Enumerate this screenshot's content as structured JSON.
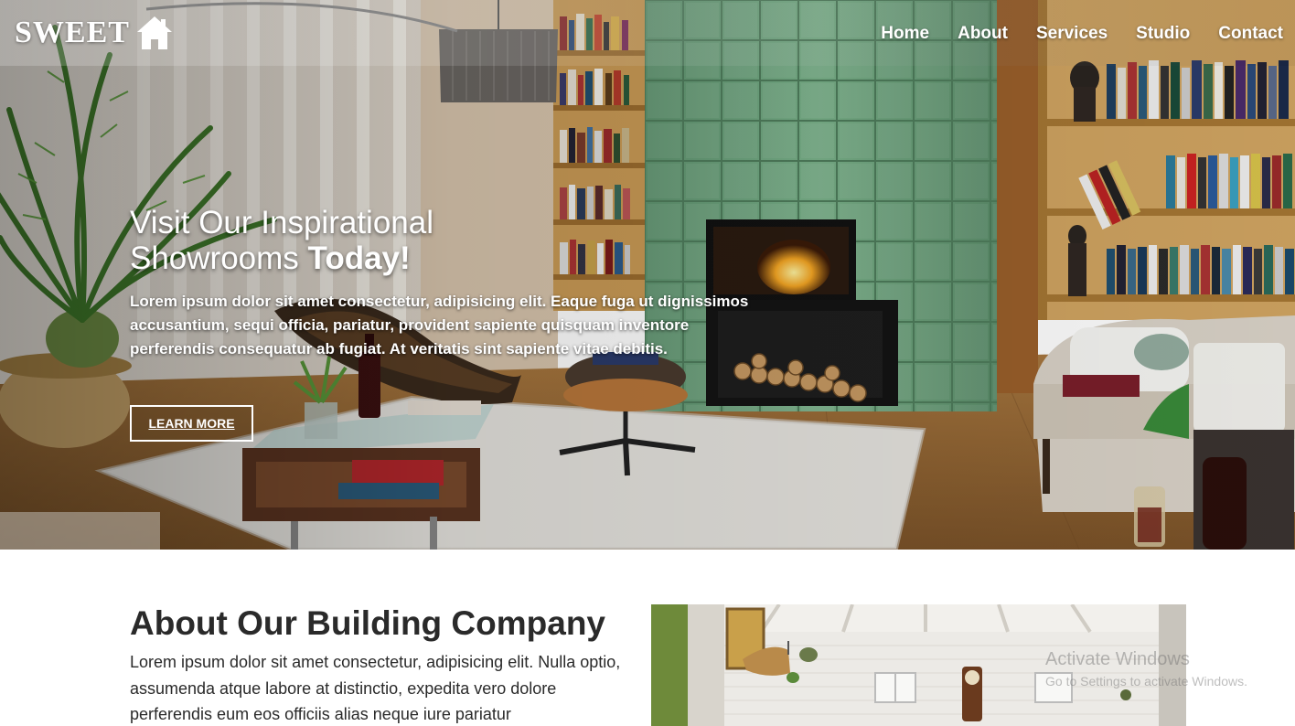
{
  "brand": {
    "name": "SWEET",
    "logo_icon": "house-icon"
  },
  "nav": {
    "items": [
      "Home",
      "About",
      "Services",
      "Studio",
      "Contact"
    ]
  },
  "hero": {
    "title_light": "Visit Our Inspirational Showrooms",
    "title_bold": "Today!",
    "text": "Lorem ipsum dolor sit amet consectetur, adipisicing elit. Eaque fuga ut dignissimos accusantium, sequi officia, pariatur, provident sapiente quisquam inventore perferendis consequatur ab fugiat. At veritatis sint sapiente vitae debitis.",
    "button_label": "LEARN MORE"
  },
  "about": {
    "title": "About Our Building Company",
    "text": "Lorem ipsum dolor sit amet consectetur, adipisicing elit. Nulla optio, assumenda atque labore at distinctio, expedita vero dolore perferendis eum eos officiis alias neque iure pariatur"
  },
  "watermark": {
    "title": "Activate Windows",
    "subtitle": "Go to Settings to activate Windows."
  },
  "colors": {
    "accent_green": "#6fa07c",
    "wood": "#b07a3c",
    "text_dark": "#2a2a2a",
    "white": "#ffffff"
  }
}
